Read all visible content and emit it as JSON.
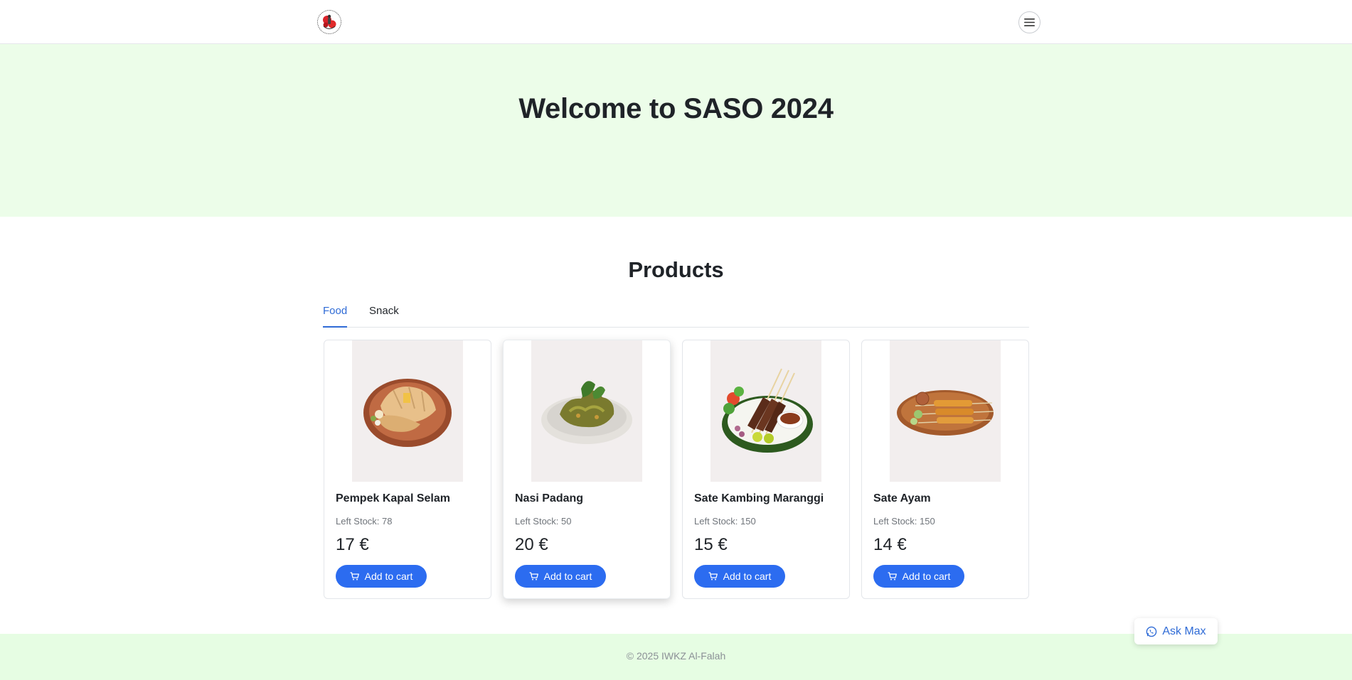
{
  "header": {
    "logo_icon": "event-logo",
    "menu_icon": "hamburger-menu-icon"
  },
  "hero": {
    "title": "Welcome to SASO 2024"
  },
  "products": {
    "title": "Products",
    "tabs": [
      {
        "label": "Food",
        "active": true
      },
      {
        "label": "Snack",
        "active": false
      }
    ],
    "items": [
      {
        "name": "Pempek Kapal Selam",
        "stock": "Left Stock: 78",
        "price": "17 €",
        "button": "Add to cart"
      },
      {
        "name": "Nasi Padang",
        "stock": "Left Stock: 50",
        "price": "20 €",
        "button": "Add to cart"
      },
      {
        "name": "Sate Kambing Maranggi",
        "stock": "Left Stock: 150",
        "price": "15 €",
        "button": "Add to cart"
      },
      {
        "name": "Sate Ayam",
        "stock": "Left Stock: 150",
        "price": "14 €",
        "button": "Add to cart"
      }
    ]
  },
  "chat": {
    "label": "Ask Max",
    "icon": "whatsapp-icon"
  },
  "footer": {
    "text": "© 2025 IWKZ Al-Falah"
  },
  "colors": {
    "hero_bg": "#ecfde9",
    "footer_bg": "#e6fde3",
    "primary": "#2c6cf0",
    "tab_active": "#2f6bd6"
  }
}
